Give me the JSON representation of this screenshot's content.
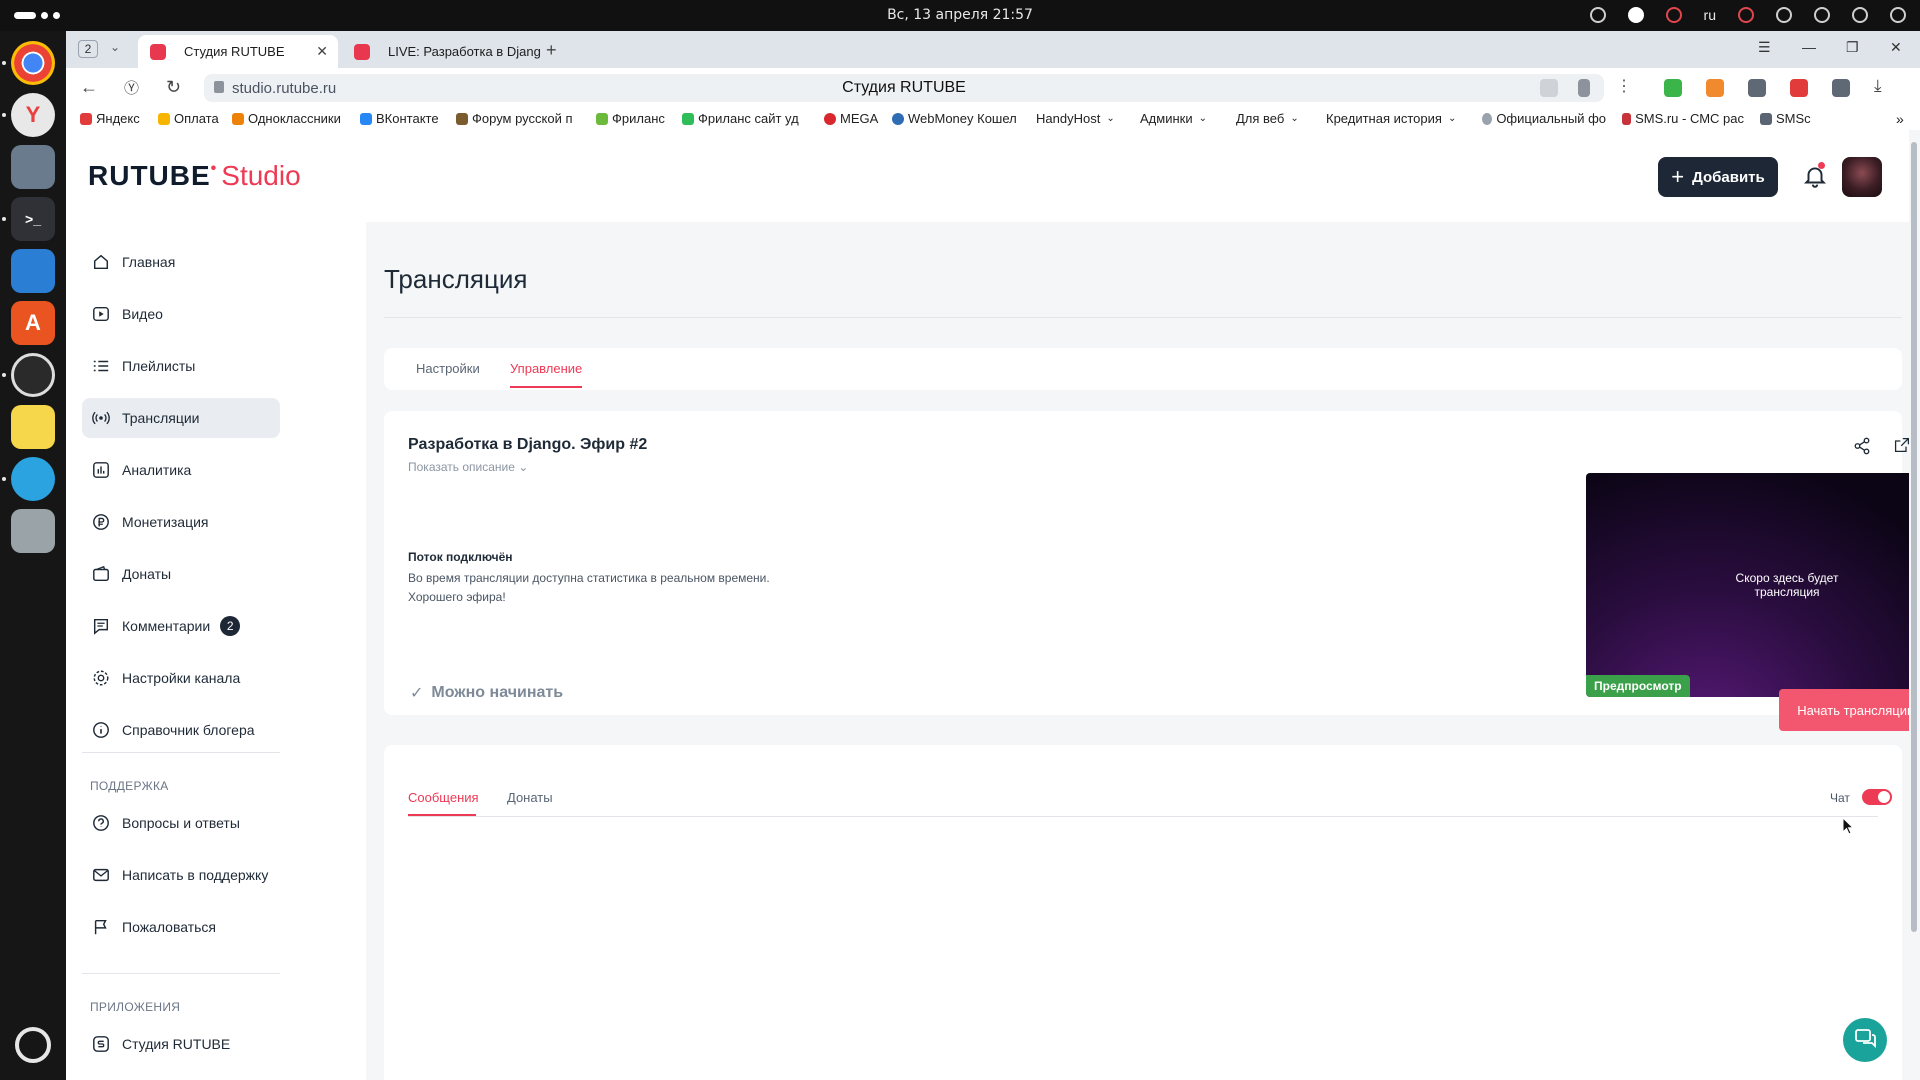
{
  "system": {
    "clock": "Вс, 13 апреля  21:57",
    "lang": "ru"
  },
  "browser": {
    "tab_count": "2",
    "tabs": [
      {
        "title": "Студия RUTUBE"
      },
      {
        "title": "LIVE: Разработка в Djang"
      }
    ],
    "url": "studio.rutube.ru",
    "page_title": "Студия RUTUBE",
    "bookmarks": [
      {
        "label": "Яндекс"
      },
      {
        "label": "Оплата"
      },
      {
        "label": "Одноклассники"
      },
      {
        "label": "ВКонтакте"
      },
      {
        "label": "Форум русской п"
      },
      {
        "label": "Фриланс"
      },
      {
        "label": "Фриланс сайт уд"
      },
      {
        "label": "MEGA"
      },
      {
        "label": "WebMoney Кошел"
      },
      {
        "label": "HandyHost"
      },
      {
        "label": "Админки"
      },
      {
        "label": "Для веб"
      },
      {
        "label": "Кредитная история"
      },
      {
        "label": "Официальный фо"
      },
      {
        "label": "SMS.ru - СМС рас"
      },
      {
        "label": "SMSc"
      }
    ]
  },
  "header": {
    "logo_main": "RUTUBE",
    "logo_sub": "Studio",
    "add_label": "Добавить"
  },
  "sidebar": {
    "items": [
      {
        "label": "Главная"
      },
      {
        "label": "Видео"
      },
      {
        "label": "Плейлисты"
      },
      {
        "label": "Трансляции"
      },
      {
        "label": "Аналитика"
      },
      {
        "label": "Монетизация"
      },
      {
        "label": "Донаты"
      },
      {
        "label": "Комментарии",
        "badge": "2"
      },
      {
        "label": "Настройки канала"
      },
      {
        "label": "Справочник блогера"
      }
    ],
    "support_title": "ПОДДЕРЖКА",
    "support_items": [
      {
        "label": "Вопросы и ответы"
      },
      {
        "label": "Написать в поддержку"
      },
      {
        "label": "Пожаловаться"
      }
    ],
    "apps_title": "ПРИЛОЖЕНИЯ",
    "apps_items": [
      {
        "label": "Студия RUTUBE"
      }
    ]
  },
  "main": {
    "page_title": "Трансляция",
    "tabs": [
      {
        "label": "Настройки"
      },
      {
        "label": "Управление"
      }
    ],
    "stream": {
      "title": "Разработка в Django. Эфир #2",
      "show_description": "Показать описание",
      "status_title": "Поток подключён",
      "info_line1": "Во время трансляции доступна статистика в реальном времени.",
      "info_line2": "Хорошего эфира!",
      "ready_label": "Можно начинать",
      "preview_text": "Скоро здесь будет трансляция",
      "preview_badge": "Предпросмотр",
      "start_label": "Начать трансляцию"
    },
    "chat": {
      "tabs": [
        {
          "label": "Сообщения"
        },
        {
          "label": "Донаты"
        }
      ],
      "toggle_label": "Чат",
      "toggle_on": true
    }
  },
  "colors": {
    "accent": "#ed3a55",
    "dark_button": "#1e2735",
    "start_button": "#f2576f",
    "preview_badge": "#3aa04a"
  }
}
